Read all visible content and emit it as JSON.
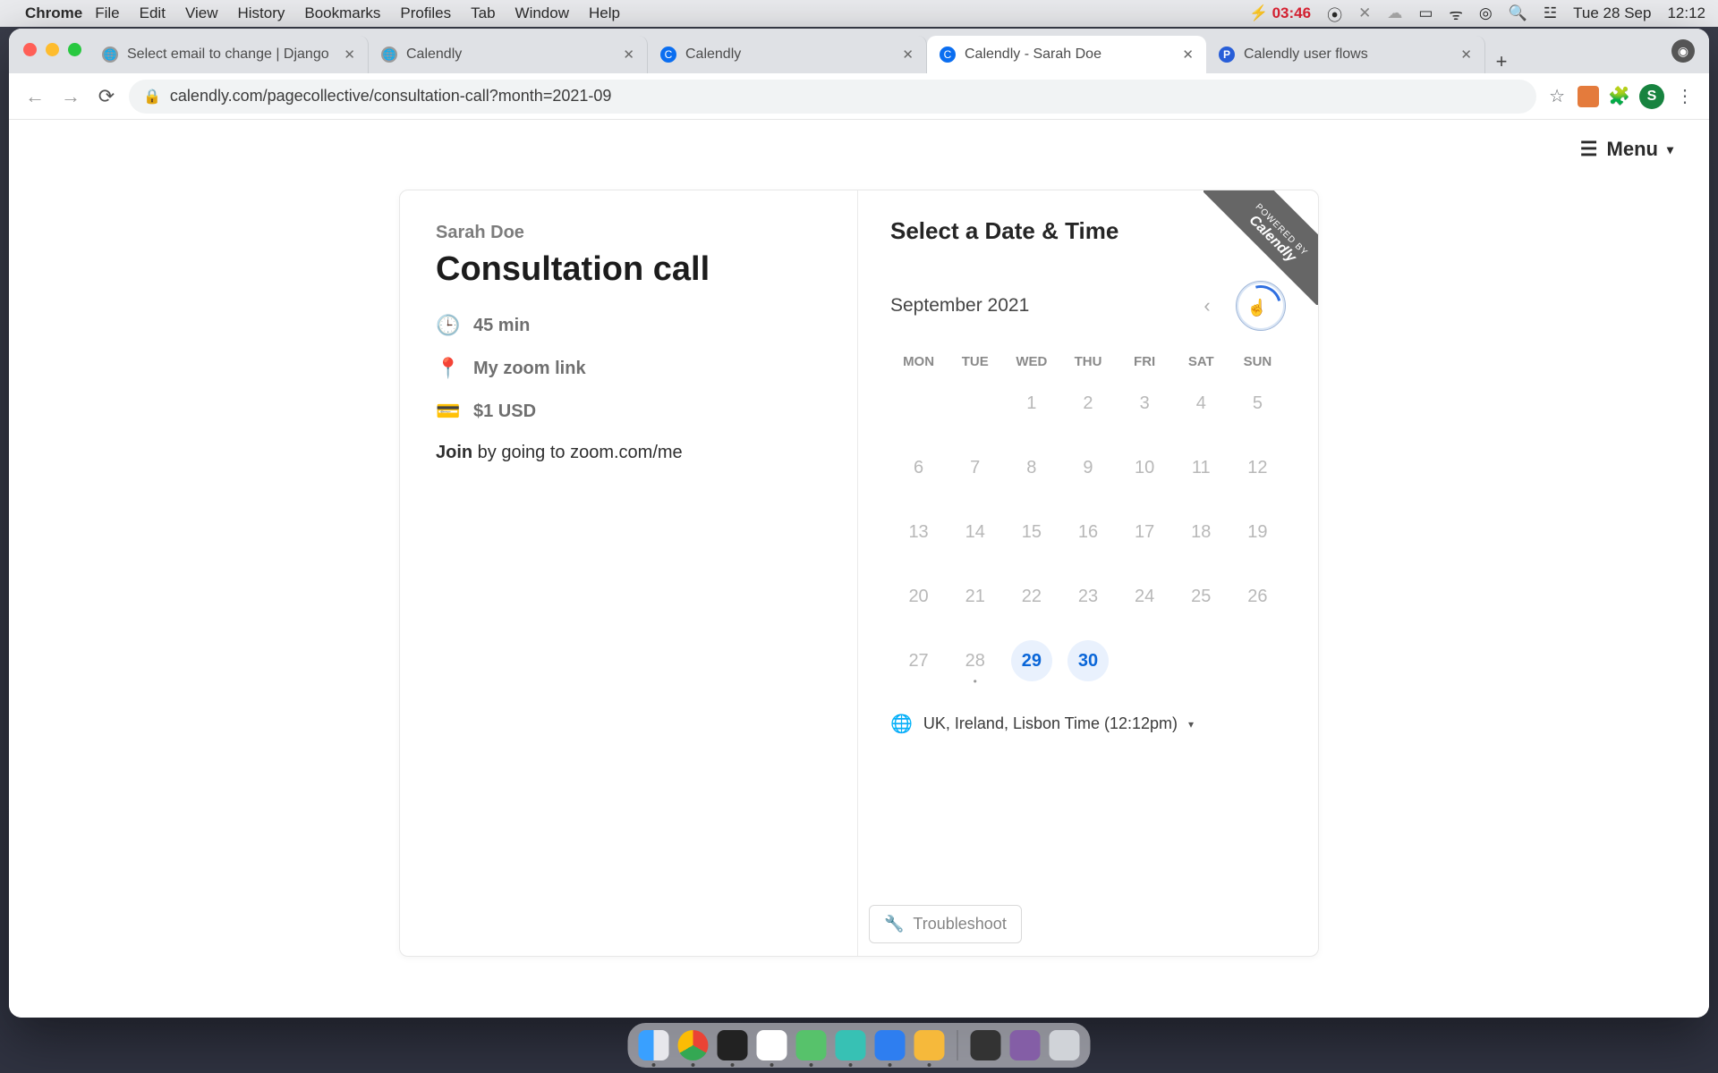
{
  "menubar": {
    "app": "Chrome",
    "items": [
      "File",
      "Edit",
      "View",
      "History",
      "Bookmarks",
      "Profiles",
      "Tab",
      "Window",
      "Help"
    ],
    "battery": "03:46",
    "date": "Tue 28 Sep",
    "time": "12:12"
  },
  "tabs": [
    {
      "title": "Select email to change | Django",
      "fav": "globe"
    },
    {
      "title": "Calendly",
      "fav": "globe"
    },
    {
      "title": "Calendly",
      "fav": "cal"
    },
    {
      "title": "Calendly - Sarah Doe",
      "fav": "cal",
      "active": true
    },
    {
      "title": "Calendly user flows",
      "fav": "p"
    }
  ],
  "omnibox": {
    "url": "calendly.com/pagecollective/consultation-call?month=2021-09",
    "profile_initial": "S"
  },
  "topmenu": {
    "label": "Menu"
  },
  "event": {
    "host": "Sarah Doe",
    "title": "Consultation call",
    "duration": "45 min",
    "location": "My zoom link",
    "price": "$1 USD",
    "desc_bold": "Join",
    "desc_rest": " by going to zoom.com/me"
  },
  "booking": {
    "heading": "Select a Date & Time",
    "month": "September 2021",
    "weekdays": [
      "MON",
      "TUE",
      "WED",
      "THU",
      "FRI",
      "SAT",
      "SUN"
    ],
    "days": [
      {
        "n": "",
        "blank": true
      },
      {
        "n": "",
        "blank": true
      },
      {
        "n": "1"
      },
      {
        "n": "2"
      },
      {
        "n": "3"
      },
      {
        "n": "4"
      },
      {
        "n": "5"
      },
      {
        "n": "6"
      },
      {
        "n": "7"
      },
      {
        "n": "8"
      },
      {
        "n": "9"
      },
      {
        "n": "10"
      },
      {
        "n": "11"
      },
      {
        "n": "12"
      },
      {
        "n": "13"
      },
      {
        "n": "14"
      },
      {
        "n": "15"
      },
      {
        "n": "16"
      },
      {
        "n": "17"
      },
      {
        "n": "18"
      },
      {
        "n": "19"
      },
      {
        "n": "20"
      },
      {
        "n": "21"
      },
      {
        "n": "22"
      },
      {
        "n": "23"
      },
      {
        "n": "24"
      },
      {
        "n": "25"
      },
      {
        "n": "26"
      },
      {
        "n": "27"
      },
      {
        "n": "28",
        "today": true
      },
      {
        "n": "29",
        "avail": true
      },
      {
        "n": "30",
        "avail": true
      },
      {
        "n": "",
        "blank": true
      },
      {
        "n": "",
        "blank": true
      },
      {
        "n": "",
        "blank": true
      }
    ],
    "timezone": "UK, Ireland, Lisbon Time (12:12pm)",
    "troubleshoot": "Troubleshoot",
    "ribbon_small": "POWERED BY",
    "ribbon_big": "Calendly"
  }
}
